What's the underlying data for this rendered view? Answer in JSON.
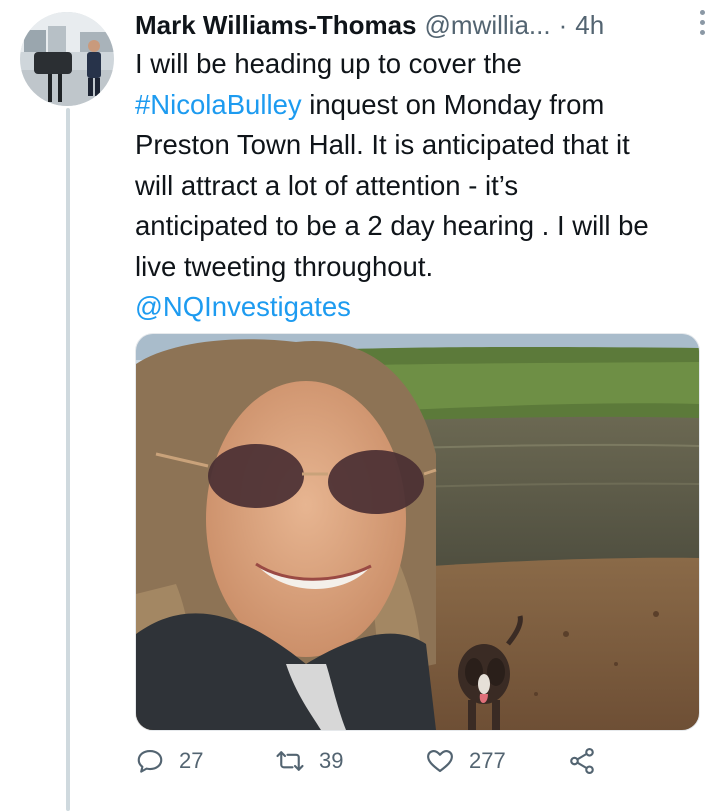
{
  "tweet": {
    "author_name": "Mark Williams-Thomas",
    "author_handle": "@mwillia...",
    "separator": "·",
    "timestamp": "4h",
    "text_line1": "I will be heading up to cover the",
    "hashtag": "#NicolaBulley",
    "text_line2_rest": " inquest on Monday from",
    "text_line3": "Preston Town Hall. It is anticipated that it",
    "text_line4": "will attract a lot of attention - it’s",
    "text_line5": "anticipated to be a 2 day hearing . I will be",
    "text_line6": "live tweeting throughout.",
    "mention": "@NQInvestigates"
  },
  "actions": {
    "reply_count": "27",
    "retweet_count": "39",
    "like_count": "277"
  },
  "icons": {
    "reply": "reply-icon",
    "retweet": "retweet-icon",
    "like": "heart-icon",
    "share": "share-icon",
    "more": "more-icon"
  },
  "colors": {
    "link": "#1d9bf0",
    "secondary_text": "#536471",
    "thread_line": "#cfd9de"
  }
}
